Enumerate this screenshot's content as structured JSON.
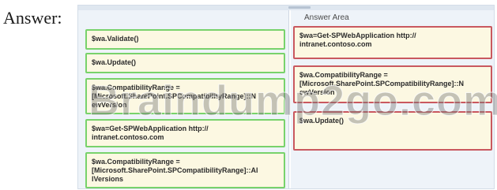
{
  "answer_label": "Answer:",
  "answer_area_title": "Answer Area",
  "watermark": "Braindump2go.com",
  "colors": {
    "source_border": "#78d26b",
    "answer_border": "#c9585f",
    "tile_fill": "#fcf8e2",
    "panel_bg": "#eef3f9"
  },
  "source_tiles": [
    {
      "text": "$wa.Validate()"
    },
    {
      "text": "$wa.Update()"
    },
    {
      "text": "$wa.CompatibilityRange =\n[Microsoft.SharePoint.SPCompatibilityRange]::N\newVersion"
    },
    {
      "text": "$wa=Get-SPWebApplication http://\nintranet.contoso.com"
    },
    {
      "text": "$wa.CompatibilityRange =\n[Microsoft.SharePoint.SPCompatibilityRange]::Al\nlVersions"
    }
  ],
  "answer_tiles": [
    {
      "text": "$wa=Get-SPWebApplication http://\nintranet.contoso.com"
    },
    {
      "text": "$wa.CompatibilityRange =\n[Microsoft.SharePoint.SPCompatibilityRange]::N\newVersion"
    },
    {
      "text": "$wa.Update()"
    }
  ]
}
